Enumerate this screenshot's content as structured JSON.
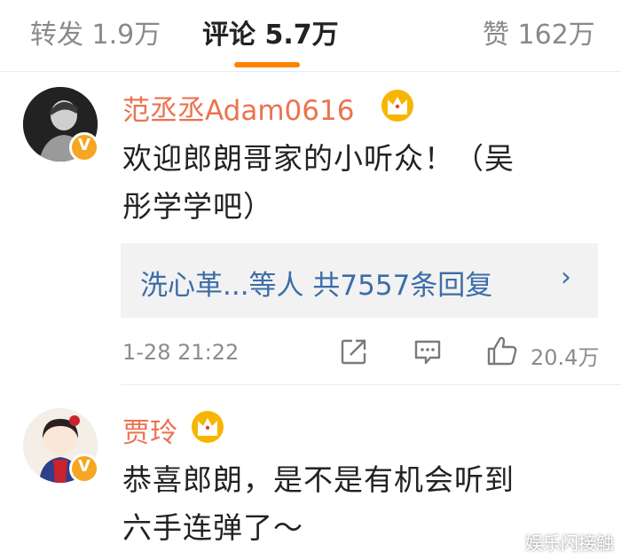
{
  "tabs": [
    {
      "label": "转发 1.9万"
    },
    {
      "label": "评论 5.7万"
    },
    {
      "label": "赞 162万"
    }
  ],
  "accent_color": "#ff8200",
  "comments": [
    {
      "username": "范丞丞Adam0616",
      "text_line1": "欢迎郎朗哥家的小听众！（吴",
      "text_line2": "彤学学吧）",
      "reply_summary": "洗心革...等人  共7557条回复",
      "reply_arrow": "›",
      "timestamp": "1-28 21:22",
      "like_count": "20.4万"
    },
    {
      "username": "贾玲",
      "text_line1": "恭喜郎朗，是不是有机会听到",
      "text_line2": "六手连弹了～"
    }
  ],
  "verified_badge": "V",
  "watermark": "娱乐闪接触"
}
